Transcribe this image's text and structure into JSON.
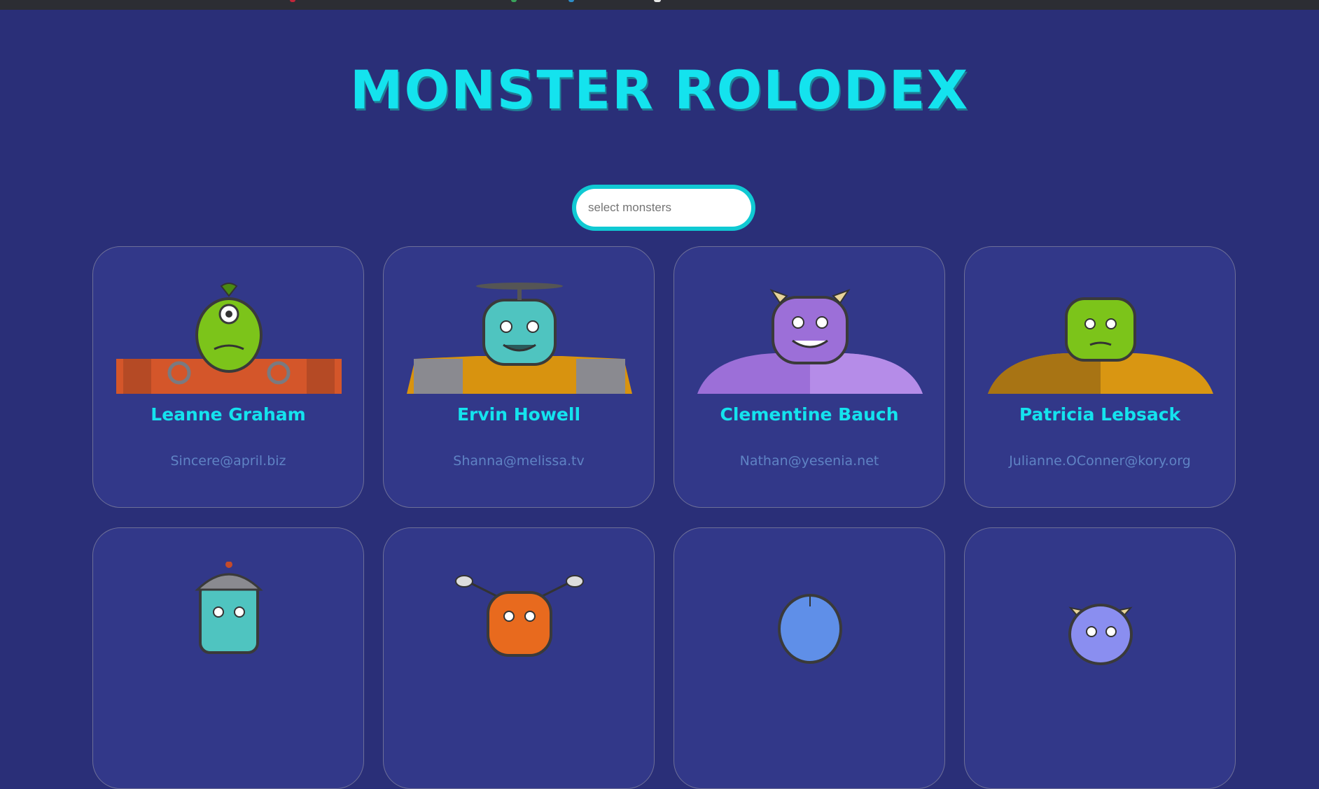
{
  "app": {
    "title": "Monster Rolodex"
  },
  "search": {
    "placeholder": "select monsters",
    "value": ""
  },
  "colors": {
    "background": "#2a2f78",
    "card_background": "#323889",
    "accent": "#14e3ee",
    "email_text": "#5f83c4"
  },
  "monsters": [
    {
      "name": "Leanne Graham",
      "email": "Sincere@april.biz",
      "avatar_icon": "green-cyclops-robot-monster-icon"
    },
    {
      "name": "Ervin Howell",
      "email": "Shanna@melissa.tv",
      "avatar_icon": "teal-propeller-monster-icon"
    },
    {
      "name": "Clementine Bauch",
      "email": "Nathan@yesenia.net",
      "avatar_icon": "purple-horned-monster-icon"
    },
    {
      "name": "Patricia Lebsack",
      "email": "Julianne.OConner@kory.org",
      "avatar_icon": "green-stitched-monster-icon"
    },
    {
      "name": "",
      "email": "",
      "avatar_icon": "teal-helmet-robot-monster-icon"
    },
    {
      "name": "",
      "email": "",
      "avatar_icon": "orange-antenna-monster-icon"
    },
    {
      "name": "",
      "email": "",
      "avatar_icon": "blue-stitched-monster-icon"
    },
    {
      "name": "",
      "email": "",
      "avatar_icon": "periwinkle-horned-monster-icon"
    }
  ]
}
